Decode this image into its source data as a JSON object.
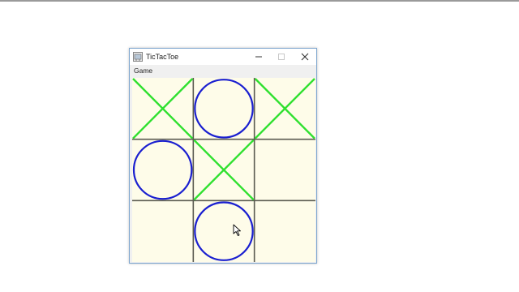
{
  "window": {
    "title": "TicTacToe"
  },
  "menu": {
    "items": [
      "Game"
    ]
  },
  "board": {
    "cells": [
      "X",
      "O",
      "X",
      "O",
      "X",
      "",
      "",
      "O",
      ""
    ]
  },
  "colors": {
    "board_bg": "#fefce9",
    "grid_line": "#5a5a50",
    "x_mark": "#2fe02f",
    "o_mark": "#1a1fd0",
    "window_border": "#7ea6cf"
  }
}
